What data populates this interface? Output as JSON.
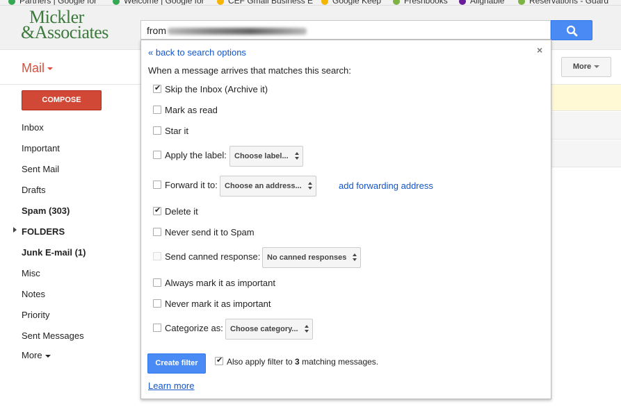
{
  "bookmarks": [
    {
      "label": "Partners | Google for",
      "color": "#34a853"
    },
    {
      "label": "Welcome | Google for",
      "color": "#34a853"
    },
    {
      "label": "CEF Gmail Business E",
      "color": "#f4b400"
    },
    {
      "label": "Google Keep",
      "color": "#f4b400"
    },
    {
      "label": "Freshbooks",
      "color": "#7cb342"
    },
    {
      "label": "Alignable",
      "color": "#6a1b9a"
    },
    {
      "label": "Reservations - Guard",
      "color": "#7cb342"
    }
  ],
  "logo": {
    "line1": "Mickler",
    "line2": "&Associates"
  },
  "search": {
    "value": "from"
  },
  "app": {
    "mail_label": "Mail"
  },
  "toolbar": {
    "more_label": "More"
  },
  "sidebar": {
    "compose_label": "COMPOSE",
    "items": [
      {
        "label": "Inbox",
        "bold": false
      },
      {
        "label": "Important",
        "bold": false
      },
      {
        "label": "Sent Mail",
        "bold": false
      },
      {
        "label": "Drafts",
        "bold": false
      },
      {
        "label": "Spam (303)",
        "bold": true
      },
      {
        "label": "FOLDERS",
        "bold": true
      },
      {
        "label": "Junk E-mail (1)",
        "bold": true
      },
      {
        "label": "Misc",
        "bold": false
      },
      {
        "label": "Notes",
        "bold": false
      },
      {
        "label": "Priority",
        "bold": false
      },
      {
        "label": "Sent Messages",
        "bold": false
      }
    ],
    "more_label": "More"
  },
  "filter": {
    "back_link": "« back to search options",
    "close": "×",
    "when_text": "When a message arrives that matches this search:",
    "options": {
      "skip_inbox": {
        "label": "Skip the Inbox (Archive it)",
        "checked": true
      },
      "mark_read": {
        "label": "Mark as read",
        "checked": false
      },
      "star": {
        "label": "Star it",
        "checked": false
      },
      "apply_label": {
        "label": "Apply the label:",
        "checked": false,
        "select": "Choose label..."
      },
      "forward": {
        "label": "Forward it to:",
        "checked": false,
        "select": "Choose an address...",
        "link": "add forwarding address"
      },
      "delete": {
        "label": "Delete it",
        "checked": true
      },
      "never_spam": {
        "label": "Never send it to Spam",
        "checked": false
      },
      "canned": {
        "label": "Send canned response:",
        "checked": false,
        "select": "No canned responses"
      },
      "always_important": {
        "label": "Always mark it as important",
        "checked": false
      },
      "never_important": {
        "label": "Never mark it as important",
        "checked": false
      },
      "categorize": {
        "label": "Categorize as:",
        "checked": false,
        "select": "Choose category..."
      }
    },
    "create_button": "Create filter",
    "also_apply": {
      "prefix": "Also apply filter to ",
      "count": "3",
      "suffix": " matching messages.",
      "checked": true
    },
    "learn_more": "Learn more"
  }
}
